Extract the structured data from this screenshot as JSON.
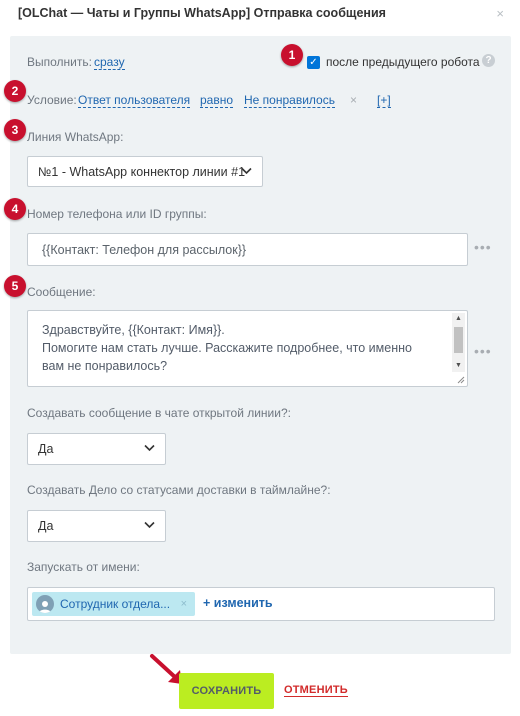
{
  "dialog": {
    "title": "[OLChat — Чаты и Группы WhatsApp] Отправка сообщения",
    "close_glyph": "×"
  },
  "badges": [
    "1",
    "2",
    "3",
    "4",
    "5"
  ],
  "execute": {
    "label": "Выполнить:",
    "value": "сразу",
    "after_robot_label": "после предыдущего робота",
    "after_robot_checked": true,
    "help_glyph": "?"
  },
  "condition": {
    "label": "Условие:",
    "field": "Ответ пользователя",
    "operator": "равно",
    "value": "Не понравилось",
    "remove_glyph": "×",
    "add": "[+]"
  },
  "line": {
    "label": "Линия WhatsApp:",
    "selected": "№1 - WhatsApp коннектор линии #1"
  },
  "phone": {
    "label": "Номер телефона или ID группы:",
    "value": "{{Контакт: Телефон для рассылок}}"
  },
  "message": {
    "label": "Сообщение:",
    "lines": [
      "Здравствуйте, {{Контакт: Имя}}.",
      "Помогите нам стать лучше. Расскажите подробнее, что именно",
      "вам не понравилось?"
    ]
  },
  "create_in_chat": {
    "label": "Создавать сообщение в чате открытой линии?:",
    "selected": "Да"
  },
  "create_task": {
    "label": "Создавать Дело со статусами доставки в таймлайне?:",
    "selected": "Да"
  },
  "run_as": {
    "label": "Запускать от имени:",
    "user": "Сотрудник отдела...",
    "remove_glyph": "×",
    "change": "+ изменить"
  },
  "footer": {
    "save": "СОХРАНИТЬ",
    "cancel": "ОТМЕНИТЬ"
  },
  "colors": {
    "badge": "#c8102e",
    "link": "#2067b0",
    "save_button": "#bbed21",
    "cancel": "#d22b2b",
    "panel": "#eef2f4"
  }
}
